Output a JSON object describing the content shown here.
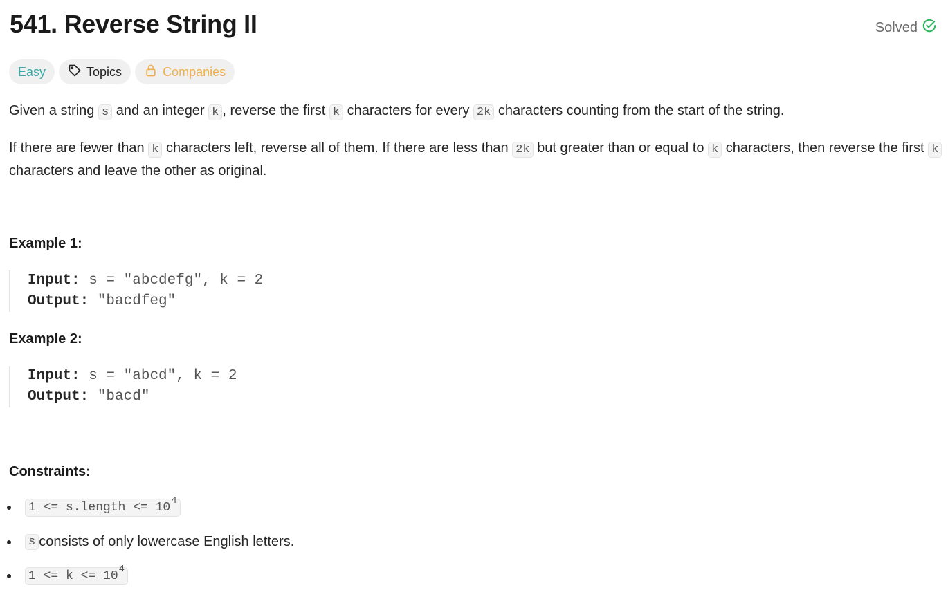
{
  "title": "541. Reverse String II",
  "status": "Solved",
  "tags": {
    "difficulty": "Easy",
    "topics": "Topics",
    "companies": "Companies"
  },
  "description": {
    "p1": {
      "t1": "Given a string ",
      "c1": "s",
      "t2": " and an integer ",
      "c2": "k",
      "t3": ", reverse the first ",
      "c3": "k",
      "t4": " characters for every ",
      "c4": "2k",
      "t5": " characters counting from the start of the string."
    },
    "p2": {
      "t1": "If there are fewer than ",
      "c1": "k",
      "t2": " characters left, reverse all of them. If there are less than ",
      "c2": "2k",
      "t3": " but greater than or equal to ",
      "c3": "k",
      "t4": " characters, then reverse the first ",
      "c4": "k",
      "t5": " characters and leave the other as original."
    }
  },
  "examples": [
    {
      "heading": "Example 1:",
      "input_label": "Input:",
      "input": " s = \"abcdefg\", k = 2",
      "output_label": "Output:",
      "output": " \"bacdfeg\""
    },
    {
      "heading": "Example 2:",
      "input_label": "Input:",
      "input": " s = \"abcd\", k = 2",
      "output_label": "Output:",
      "output": " \"bacd\""
    }
  ],
  "constraints": {
    "heading": "Constraints:",
    "c1": {
      "text": "1 <= s.length <= 10",
      "sup": "4"
    },
    "c2": {
      "code": "s",
      "text": " consists of only lowercase English letters."
    },
    "c3": {
      "text": "1 <= k <= 10",
      "sup": "4"
    }
  },
  "colors": {
    "easy": "#3fa8a9",
    "companies": "#f0b04e",
    "solved_check": "#2db55d"
  }
}
